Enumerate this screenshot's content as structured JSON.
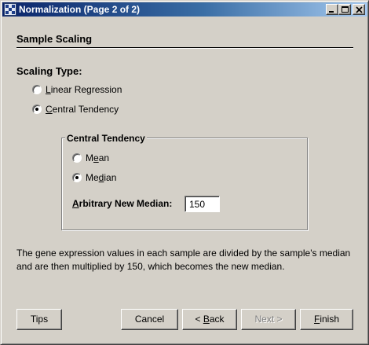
{
  "window": {
    "title": "Normalization (Page 2 of 2)",
    "controls": {
      "minimize": "minimize-icon",
      "maximize": "maximize-icon",
      "close": "close-icon"
    }
  },
  "section": {
    "title": "Sample Scaling"
  },
  "scaling_type": {
    "label": "Scaling Type:",
    "options": [
      {
        "label": "Linear Regression",
        "mnemonic": "L",
        "rest": "inear Regression",
        "selected": false
      },
      {
        "label": "Central Tendency",
        "mnemonic": "C",
        "rest": "entral Tendency",
        "selected": true
      }
    ]
  },
  "central_tendency": {
    "title": "Central Tendency",
    "options": [
      {
        "label": "Mean",
        "before": "M",
        "mnemonic": "e",
        "rest": "an",
        "selected": false
      },
      {
        "label": "Median",
        "before": "Me",
        "mnemonic": "d",
        "rest": "ian",
        "selected": true
      }
    ],
    "median_field": {
      "label": "Arbitrary New Median:",
      "mnemonic": "A",
      "rest": "rbitrary New Median:",
      "value": "150"
    }
  },
  "description": "The gene expression values in each sample are divided by the sample's median and are then multiplied by 150, which becomes the new median.",
  "buttons": {
    "tips": "Tips",
    "cancel": "Cancel",
    "back": {
      "label": "< Back",
      "prefix": "< ",
      "mnemonic": "B",
      "rest": "ack"
    },
    "next": "Next >",
    "finish": {
      "label": "Finish",
      "mnemonic": "F",
      "rest": "inish"
    }
  }
}
